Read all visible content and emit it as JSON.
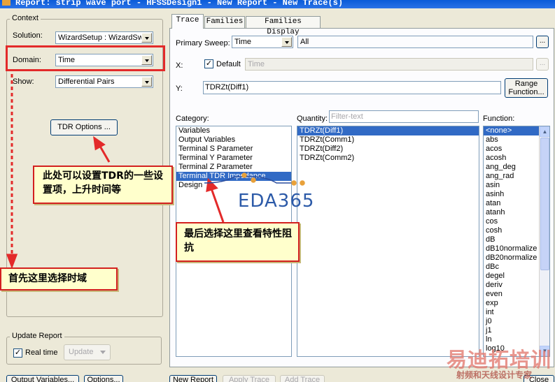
{
  "window": {
    "title": "Report: strip wave port - HFSSDesign1 - New Report - New Trace(s)"
  },
  "context": {
    "legend": "Context",
    "solution_label": "Solution:",
    "solution_value": "WizardSetup : WizardSwe",
    "domain_label": "Domain:",
    "domain_value": "Time",
    "show_label": "Show:",
    "show_value": "Differential Pairs",
    "tdr_options": "TDR Options ..."
  },
  "update_report": {
    "legend": "Update Report",
    "realtime_label": "Real time",
    "realtime_checked": true,
    "update_button": "Update"
  },
  "bottom_left_buttons": [
    "Output Variables...",
    "Options..."
  ],
  "tabs": [
    "Trace",
    "Families",
    "Families Display"
  ],
  "trace": {
    "primary_sweep_label": "Primary Sweep:",
    "primary_sweep_value": "Time",
    "primary_sweep_range": "All",
    "ellipsis": "...",
    "x_label": "X:",
    "default_label": "Default",
    "default_checked": true,
    "x_value": "Time",
    "y_label": "Y:",
    "y_value": "TDRZt(Diff1)",
    "range_function": "Range Function..."
  },
  "category": {
    "label": "Category:",
    "items": [
      "Variables",
      "Output Variables",
      "Terminal S Parameter",
      "Terminal Y Parameter",
      "Terminal Z Parameter",
      "Terminal TDR Impedance",
      "Design"
    ],
    "selected_index": 5
  },
  "quantity": {
    "label": "Quantity:",
    "filter_placeholder": "Filter-text",
    "items": [
      "TDRZt(Diff1)",
      "TDRZt(Comm1)",
      "TDRZt(Diff2)",
      "TDRZt(Comm2)"
    ],
    "selected_index": 0
  },
  "function": {
    "label": "Function:",
    "items": [
      "<none>",
      "abs",
      "acos",
      "acosh",
      "ang_deg",
      "ang_rad",
      "asin",
      "asinh",
      "atan",
      "atanh",
      "cos",
      "cosh",
      "dB",
      "dB10normalize",
      "dB20normalize",
      "dBc",
      "degel",
      "deriv",
      "even",
      "exp",
      "int",
      "j0",
      "j1",
      "ln",
      "log10"
    ],
    "selected_index": 0
  },
  "bottom_buttons": [
    "New Report",
    "Apply Trace",
    "Add Trace",
    "Close"
  ],
  "annotations": {
    "note_tdr": "此处可以设置TDR的一些设置项，上升时间等",
    "note_impedance": "最后选择这里查看特性阻抗",
    "note_domain": "首先这里选择时域",
    "arrow_color": "#e32a2a"
  },
  "watermarks": {
    "eda365": "EDA365",
    "brand_cn": "易迪拓培训",
    "brand_sub": "射频和天线设计专家"
  }
}
